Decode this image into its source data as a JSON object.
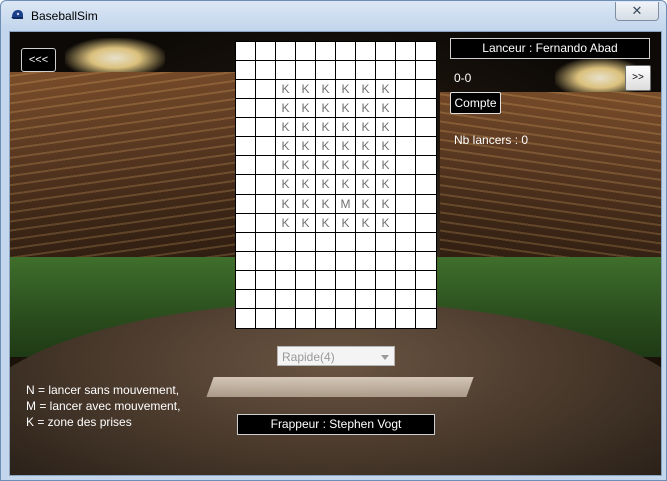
{
  "window": {
    "title": "BaseballSim",
    "close_glyph": "✕"
  },
  "nav": {
    "back_label": "<<<",
    "next_label": ">>"
  },
  "pitcher": {
    "label": "Lanceur : Fernando Abad"
  },
  "count": {
    "value": "0-0",
    "button_label": "Compte"
  },
  "pitches": {
    "label": "Nb lancers : 0"
  },
  "pitch_type": {
    "selected": "Rapide(4)"
  },
  "legend": {
    "line1": "N = lancer sans mouvement,",
    "line2": "M = lancer avec mouvement,",
    "line3": "K = zone des prises"
  },
  "batter": {
    "label": "Frappeur : Stephen Vogt"
  },
  "zone_grid": {
    "rows": [
      [
        "",
        "",
        "",
        "",
        "",
        "",
        "",
        "",
        "",
        ""
      ],
      [
        "",
        "",
        "",
        "",
        "",
        "",
        "",
        "",
        "",
        ""
      ],
      [
        "",
        "",
        "K",
        "K",
        "K",
        "K",
        "K",
        "K",
        "",
        ""
      ],
      [
        "",
        "",
        "K",
        "K",
        "K",
        "K",
        "K",
        "K",
        "",
        ""
      ],
      [
        "",
        "",
        "K",
        "K",
        "K",
        "K",
        "K",
        "K",
        "",
        ""
      ],
      [
        "",
        "",
        "K",
        "K",
        "K",
        "K",
        "K",
        "K",
        "",
        ""
      ],
      [
        "",
        "",
        "K",
        "K",
        "K",
        "K",
        "K",
        "K",
        "",
        ""
      ],
      [
        "",
        "",
        "K",
        "K",
        "K",
        "K",
        "K",
        "K",
        "",
        ""
      ],
      [
        "",
        "",
        "K",
        "K",
        "K",
        "M",
        "K",
        "K",
        "",
        ""
      ],
      [
        "",
        "",
        "K",
        "K",
        "K",
        "K",
        "K",
        "K",
        "",
        ""
      ],
      [
        "",
        "",
        "",
        "",
        "",
        "",
        "",
        "",
        "",
        ""
      ],
      [
        "",
        "",
        "",
        "",
        "",
        "",
        "",
        "",
        "",
        ""
      ],
      [
        "",
        "",
        "",
        "",
        "",
        "",
        "",
        "",
        "",
        ""
      ],
      [
        "",
        "",
        "",
        "",
        "",
        "",
        "",
        "",
        "",
        ""
      ],
      [
        "",
        "",
        "",
        "",
        "",
        "",
        "",
        "",
        "",
        ""
      ]
    ]
  }
}
